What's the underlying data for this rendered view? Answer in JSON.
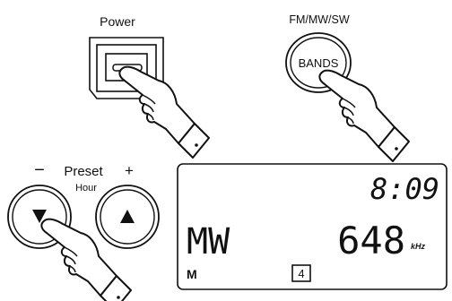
{
  "labels": {
    "power": "Power",
    "band_caption": "FM/MW/SW",
    "bands": "BANDS",
    "minus": "−",
    "preset": "Preset",
    "plus": "+",
    "hour": "Hour"
  },
  "display": {
    "time": "8:09",
    "band": "MW",
    "frequency": "648",
    "unit": "kHz",
    "mode": "M",
    "preset_number": "4"
  },
  "icons": {
    "down": "triangle-down-icon",
    "up": "triangle-up-icon",
    "hand": "pointing-hand-icon"
  },
  "colors": {
    "ink": "#111111",
    "background": "#ffffff"
  }
}
